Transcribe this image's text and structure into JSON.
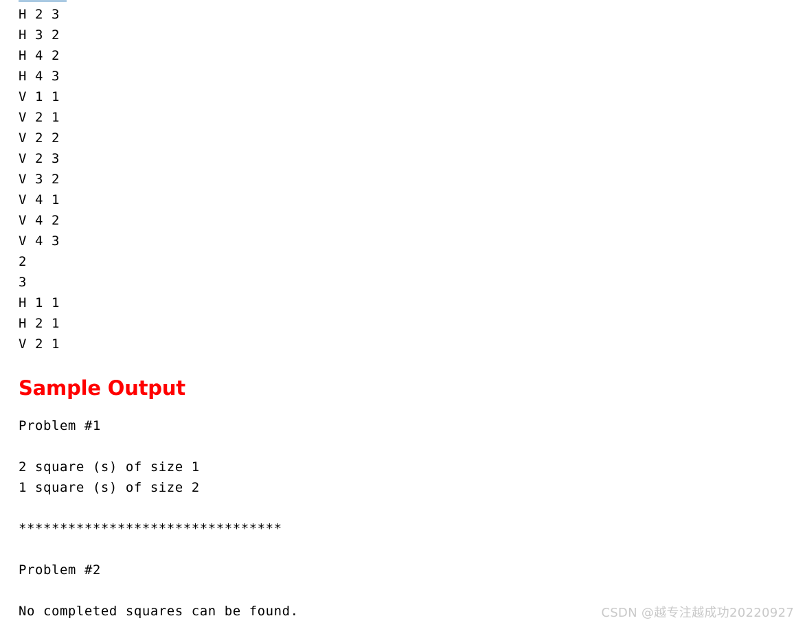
{
  "page": {
    "background_color": "#ffffff",
    "text_color": "#000000",
    "top_rule_color": "#a9c9e2"
  },
  "sample_input": {
    "lines": [
      "H 2 3",
      "H 3 2",
      "H 4 2",
      "H 4 3",
      "V 1 1",
      "V 2 1",
      "V 2 2",
      "V 2 3",
      "V 3 2",
      "V 4 1",
      "V 4 2",
      "V 4 3",
      "2",
      "3",
      "H 1 1",
      "H 2 1",
      "V 2 1"
    ],
    "text": "H 2 3\nH 3 2\nH 4 2\nH 4 3\nV 1 1\nV 2 1\nV 2 2\nV 2 3\nV 3 2\nV 4 1\nV 4 2\nV 4 3\n2\n3\nH 1 1\nH 2 1\nV 2 1"
  },
  "sample_output_heading": {
    "label": "Sample Output",
    "color": "#ff0000"
  },
  "sample_output": {
    "lines": [
      "Problem #1",
      "",
      "2 square (s) of size 1",
      "1 square (s) of size 2",
      "",
      "********************************",
      "",
      "Problem #2",
      "",
      "No completed squares can be found."
    ],
    "text": "Problem #1\n\n2 square (s) of size 1\n1 square (s) of size 2\n\n********************************\n\nProblem #2\n\nNo completed squares can be found.",
    "separator": "********************************",
    "separator_char_count": 32
  },
  "watermark": {
    "text": "CSDN @越专注越成功20220927",
    "color": "#c9c9c9"
  }
}
